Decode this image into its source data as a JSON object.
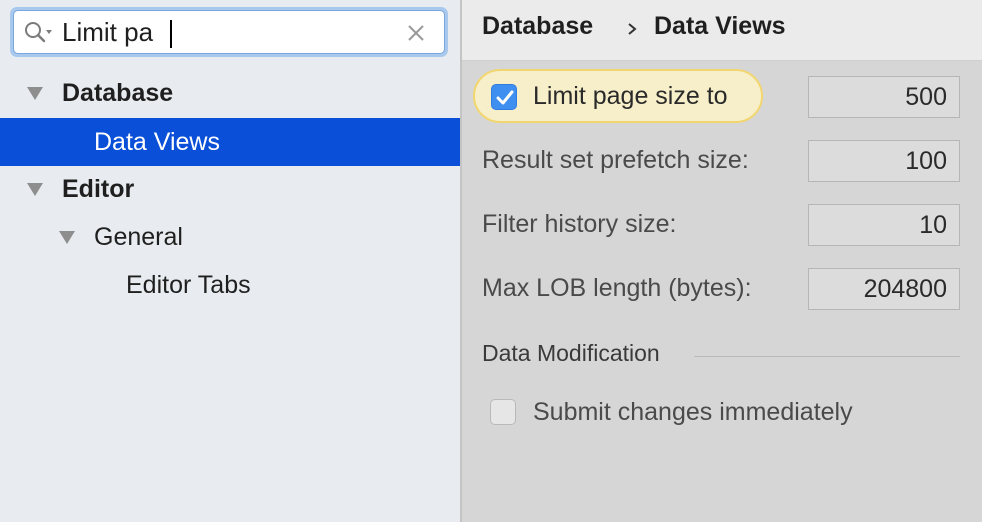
{
  "search": {
    "value": "Limit pa"
  },
  "tree": [
    {
      "label": "Database",
      "bold": true,
      "expanded": true
    },
    {
      "label": "Data Views",
      "selected": true
    },
    {
      "label": "Editor",
      "bold": true,
      "expanded": true
    },
    {
      "label": "General",
      "expanded": true
    },
    {
      "label": "Editor Tabs"
    }
  ],
  "breadcrumb": {
    "parent": "Database",
    "current": "Data Views"
  },
  "settings": {
    "limit_page_size": {
      "label": "Limit page size to",
      "checked": true,
      "value": "500"
    },
    "prefetch": {
      "label": "Result set prefetch size:",
      "value": "100"
    },
    "filter_history": {
      "label": "Filter history size:",
      "value": "10"
    },
    "max_lob": {
      "label": "Max LOB length (bytes):",
      "value": "204800"
    }
  },
  "data_modification": {
    "title": "Data Modification",
    "submit_immediately": {
      "label": "Submit changes immediately",
      "checked": false
    }
  },
  "colors": {
    "selection": "#0a4fd7",
    "checkbox_accent": "#3f8ff0",
    "search_highlight": "#f7efc9"
  },
  "icons": [
    "search-icon",
    "dropdown-caret-icon",
    "clear-icon",
    "triangle-down-icon",
    "chevron-right-icon",
    "checkmark-icon"
  ]
}
